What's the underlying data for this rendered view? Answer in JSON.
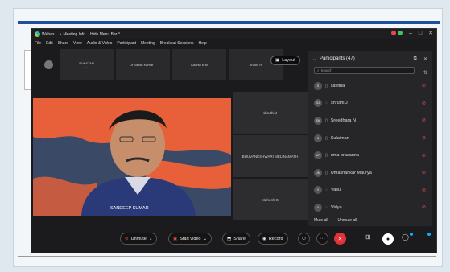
{
  "titlebar": {
    "app_name": "Webex",
    "meeting_info": "Meeting Info",
    "hide_menu_bar": "Hide Menu Bar ^"
  },
  "menu": [
    "File",
    "Edit",
    "Share",
    "View",
    "Audio & Video",
    "Participant",
    "Meeting",
    "Breakout Sessions",
    "Help"
  ],
  "thumbnails": [
    {
      "name": "BVKSTAN",
      "sub": "..."
    },
    {
      "name": "Dr Satish Kumar T",
      "sub": ""
    },
    {
      "name": "Adarsh B M",
      "sub": ""
    },
    {
      "name": "Anand R",
      "sub": ""
    }
  ],
  "layout_button": "Layout",
  "main_video": {
    "name": "SANDEEP KUMAR"
  },
  "side_tiles": [
    "shruthi J",
    "BHUVANESHWARI MELINAMATH",
    "Mahesh G"
  ],
  "participants_panel": {
    "title": "Participants (47)",
    "search_placeholder": "Search",
    "participants": [
      {
        "initials": "S",
        "name": "savitha"
      },
      {
        "initials": "SJ",
        "name": "shruthi J"
      },
      {
        "initials": "SN",
        "name": "Sreedhara N"
      },
      {
        "initials": "S",
        "name": "Sulaiman"
      },
      {
        "initials": "UP",
        "name": "uma prasanna"
      },
      {
        "initials": "UM",
        "name": "Umashankar Maurya"
      },
      {
        "initials": "V",
        "name": "Vasu"
      },
      {
        "initials": "V",
        "name": "Vidya"
      }
    ],
    "mute_all": "Mute all",
    "unmute_all": "Unmute all"
  },
  "controls": {
    "unmute": "Unmute",
    "start_video": "Start video",
    "share": "Share",
    "record": "Record"
  },
  "colors": {
    "end_call": "#e0343a",
    "muted": "#e14d4d",
    "accent": "#00b4ff"
  }
}
